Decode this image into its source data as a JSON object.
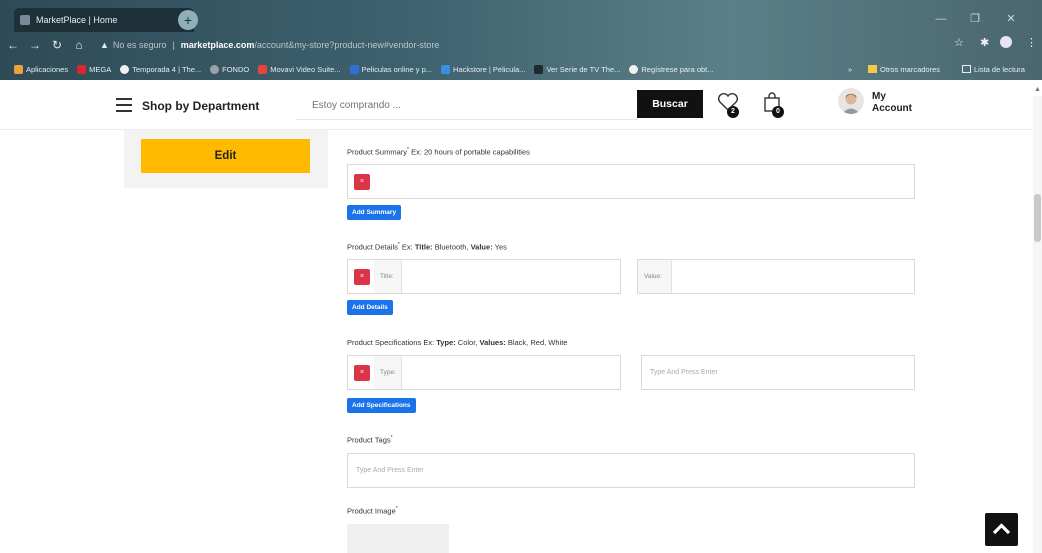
{
  "browser": {
    "tab_title": "MarketPlace | Home",
    "tab_close": "×",
    "new_tab": "+",
    "insecure_label": "No es seguro",
    "url_host": "marketplace.com",
    "url_path": "/account&my-store?product-new#vendor-store",
    "bookmarks": [
      {
        "label": "Aplicaciones",
        "color": "#e8a33a"
      },
      {
        "label": "MEGA",
        "color": "#d9272e"
      },
      {
        "label": "Temporada 4 | The...",
        "color": "#f0f0f0"
      },
      {
        "label": "FONDO",
        "color": "#9aa4a8"
      },
      {
        "label": "Movavi Video Suite...",
        "color": "#e8443a"
      },
      {
        "label": "Peliculas online y p...",
        "color": "#2f6fd6"
      },
      {
        "label": "Hackstore | Pelicula...",
        "color": "#3b8ee0"
      },
      {
        "label": "Ver Serie de TV The...",
        "color": "#1e2a30"
      },
      {
        "label": "Regístrese para obt...",
        "color": "#f0f0f0"
      }
    ],
    "more_bookmarks": "»",
    "other_bookmarks": "Otros marcadores",
    "reading_list": "Lista de lectura"
  },
  "header": {
    "department_label": "Shop by Department",
    "search_placeholder": "Estoy comprando ...",
    "search_button": "Buscar",
    "wishlist_count": "2",
    "cart_count": "0",
    "account_line1": "My",
    "account_line2": "Account"
  },
  "sidebar": {
    "edit_button": "Edit"
  },
  "form": {
    "summary": {
      "label": "Product Summary",
      "req": "*",
      "example": "Ex: 20 hours of portable capabilities",
      "add_button": "Add Summary"
    },
    "details": {
      "label": "Product Details",
      "req": "*",
      "example_prefix": "Ex:",
      "example_title_key": "Title:",
      "example_title_val": "Bluetooth,",
      "example_value_key": "Value:",
      "example_value_val": "Yes",
      "title_prefix": "Title:",
      "value_prefix": "Value:",
      "add_button": "Add Details"
    },
    "specs": {
      "label": "Product Specifications",
      "example_prefix": "Ex:",
      "example_type_key": "Type:",
      "example_type_val": "Color,",
      "example_values_key": "Values:",
      "example_values_val": "Black, Red, White",
      "type_prefix": "Type:",
      "values_placeholder": "Type And Press Enter",
      "add_button": "Add Specifications"
    },
    "tags": {
      "label": "Product Tags",
      "req": "*",
      "placeholder": "Type And Press Enter"
    },
    "image": {
      "label": "Product Image",
      "req": "*"
    },
    "delete_symbol": "×"
  },
  "colors": {
    "accent_yellow": "#ffba00",
    "primary_blue": "#1a73e8",
    "danger_red": "#dc3545",
    "dark": "#111111"
  }
}
